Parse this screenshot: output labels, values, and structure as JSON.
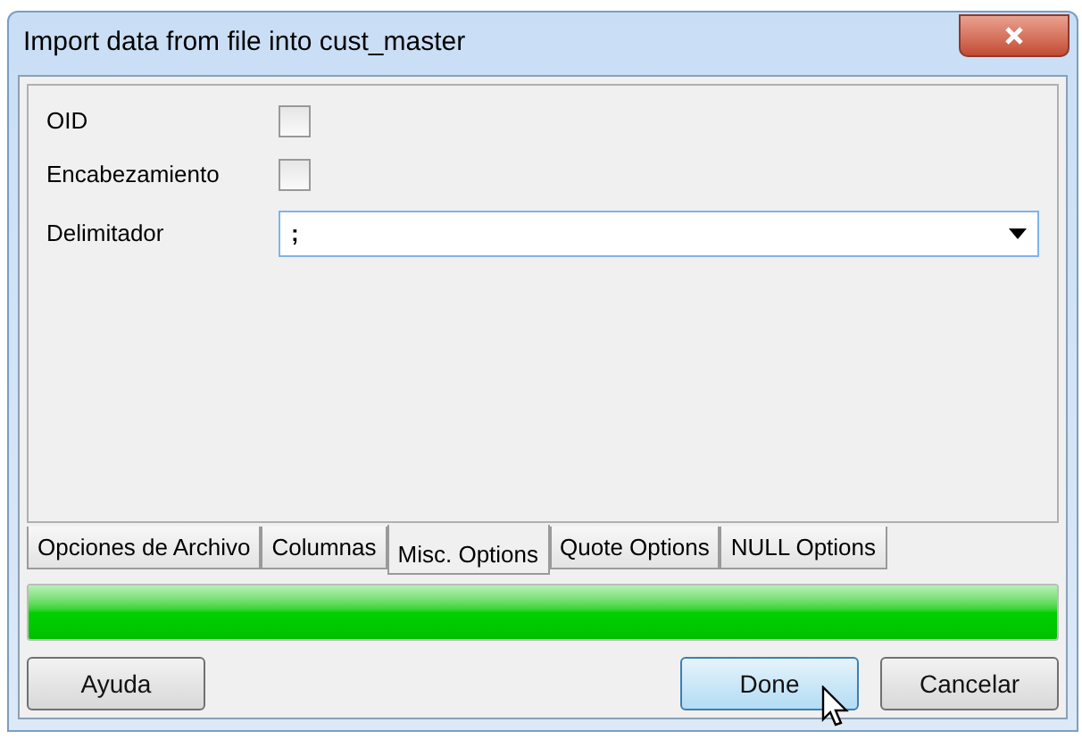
{
  "window": {
    "title": "Import data from file into cust_master"
  },
  "fields": [
    {
      "kind": "checkbox",
      "label": "OID",
      "checked": false
    },
    {
      "kind": "checkbox",
      "label": "Encabezamiento",
      "checked": false
    },
    {
      "kind": "dropdown",
      "label": "Delimitador",
      "value": ";"
    }
  ],
  "tabs": [
    {
      "label": "Opciones de Archivo",
      "selected": false
    },
    {
      "label": "Columnas",
      "selected": false
    },
    {
      "label": "Misc. Options",
      "selected": true
    },
    {
      "label": "Quote Options",
      "selected": false
    },
    {
      "label": "NULL Options",
      "selected": false
    }
  ],
  "progress": {
    "level": 1
  },
  "buttons": [
    {
      "label": "Ayuda",
      "default": false
    },
    {
      "label": "Done",
      "default": true
    },
    {
      "label": "Cancelar",
      "default": false
    }
  ]
}
